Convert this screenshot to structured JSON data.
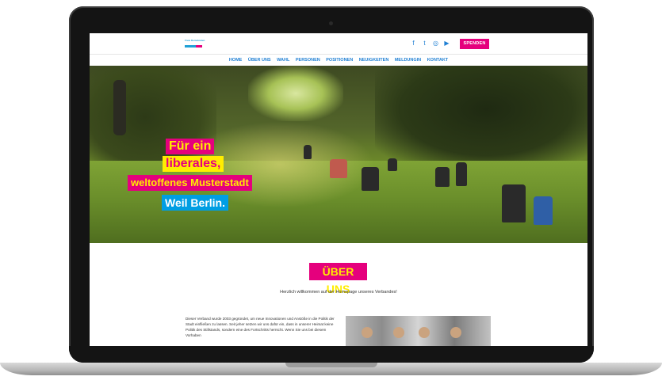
{
  "header": {
    "logo_text": "Freie Demokraten",
    "donate_label": "SPENDEN",
    "social": [
      {
        "icon": "facebook-icon",
        "glyph": "f"
      },
      {
        "icon": "twitter-icon",
        "glyph": "t"
      },
      {
        "icon": "instagram-icon",
        "glyph": "◎"
      },
      {
        "icon": "youtube-icon",
        "glyph": "▶"
      }
    ]
  },
  "nav": {
    "items": [
      "HOME",
      "ÜBER UNS",
      "WAHL",
      "PERSONEN",
      "POSITIONEN",
      "NEUIGKEITEN",
      "MELDUNGIN",
      "KONTAKT"
    ]
  },
  "hero": {
    "line1": "Für ein",
    "line2": "liberales,",
    "line3": "weltoffenes Musterstadt",
    "line4": "Weil Berlin."
  },
  "about": {
    "title": "ÜBER UNS",
    "welcome": "Herzlich willkommen auf der Homepage unseres Verbandes!",
    "body": "Dieser Verband wurde 2003 gegründet, um neue Innovationen und Anstöße in die Politik der Stadt einfließen zu lassen. Seit jeher setzen wir uns dafür ein, dass in unserer Heimat keine Politik des Stillstands, sondern eine des Fortschritts herrscht. Wenn Sie uns bei diesem Vorhaben"
  },
  "colors": {
    "magenta": "#e5007d",
    "yellow": "#ffed00",
    "cyan": "#009ee3",
    "nav_blue": "#1f7fd3"
  }
}
